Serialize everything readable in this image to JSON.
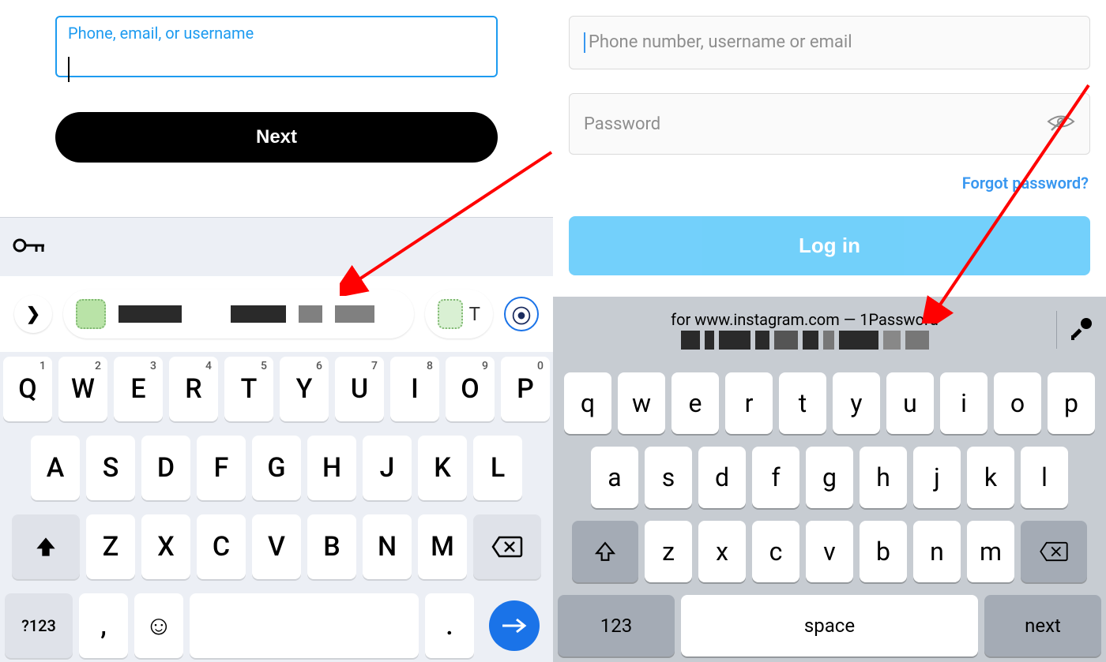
{
  "left": {
    "input_label": "Phone, email, or username",
    "next_button": "Next",
    "suggestion_tw_label": "T",
    "keyboard": {
      "row1": [
        {
          "k": "Q",
          "n": "1"
        },
        {
          "k": "W",
          "n": "2"
        },
        {
          "k": "E",
          "n": "3"
        },
        {
          "k": "R",
          "n": "4"
        },
        {
          "k": "T",
          "n": "5"
        },
        {
          "k": "Y",
          "n": "6"
        },
        {
          "k": "U",
          "n": "7"
        },
        {
          "k": "I",
          "n": "8"
        },
        {
          "k": "O",
          "n": "9"
        },
        {
          "k": "P",
          "n": "0"
        }
      ],
      "row2": [
        "A",
        "S",
        "D",
        "F",
        "G",
        "H",
        "J",
        "K",
        "L"
      ],
      "row3": [
        "Z",
        "X",
        "C",
        "V",
        "B",
        "N",
        "M"
      ],
      "numrow_label": "?123",
      "comma": ",",
      "period": "."
    }
  },
  "right": {
    "username_placeholder": "Phone number, username or email",
    "password_placeholder": "Password",
    "forgot": "Forgot password?",
    "login": "Log in",
    "suggestion_line": "for www.instagram.com — 1Password",
    "keyboard": {
      "row1": [
        "q",
        "w",
        "e",
        "r",
        "t",
        "y",
        "u",
        "i",
        "o",
        "p"
      ],
      "row2": [
        "a",
        "s",
        "d",
        "f",
        "g",
        "h",
        "j",
        "k",
        "l"
      ],
      "row3": [
        "z",
        "x",
        "c",
        "v",
        "b",
        "n",
        "m"
      ],
      "num_label": "123",
      "space_label": "space",
      "next_label": "next"
    }
  }
}
